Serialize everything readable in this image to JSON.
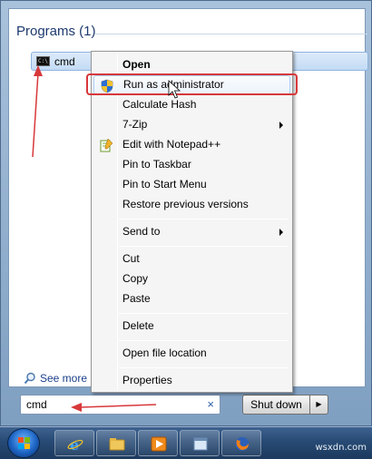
{
  "results": {
    "header": "Programs (1)",
    "item_label": "cmd",
    "see_more": "See more re"
  },
  "search": {
    "value": "cmd",
    "clear_glyph": "×"
  },
  "power": {
    "shutdown_label": "Shut down",
    "arrow_glyph": "▶"
  },
  "context_menu": {
    "items": [
      {
        "label": "Open",
        "bold": true
      },
      {
        "label": "Run as administrator",
        "icon": "uac-shield-icon"
      },
      {
        "label": "Calculate Hash"
      },
      {
        "label": "7-Zip",
        "submenu": true
      },
      {
        "label": "Edit with Notepad++",
        "icon": "notepad-plus-plus-icon"
      },
      {
        "label": "Pin to Taskbar"
      },
      {
        "label": "Pin to Start Menu"
      },
      {
        "label": "Restore previous versions"
      },
      {
        "label": "Send to",
        "submenu": true
      },
      {
        "label": "Cut"
      },
      {
        "label": "Copy"
      },
      {
        "label": "Paste"
      },
      {
        "label": "Delete"
      },
      {
        "label": "Open file location"
      },
      {
        "label": "Properties"
      }
    ]
  },
  "taskbar": {
    "buttons": [
      "internet-explorer-icon",
      "windows-explorer-icon",
      "media-player-icon",
      "window-icon",
      "firefox-icon"
    ]
  },
  "watermark": "wsxdn.com",
  "colors": {
    "annotation_red": "#d8383a",
    "highlight_border": "#aecff7",
    "taskbar": "#274a74"
  }
}
